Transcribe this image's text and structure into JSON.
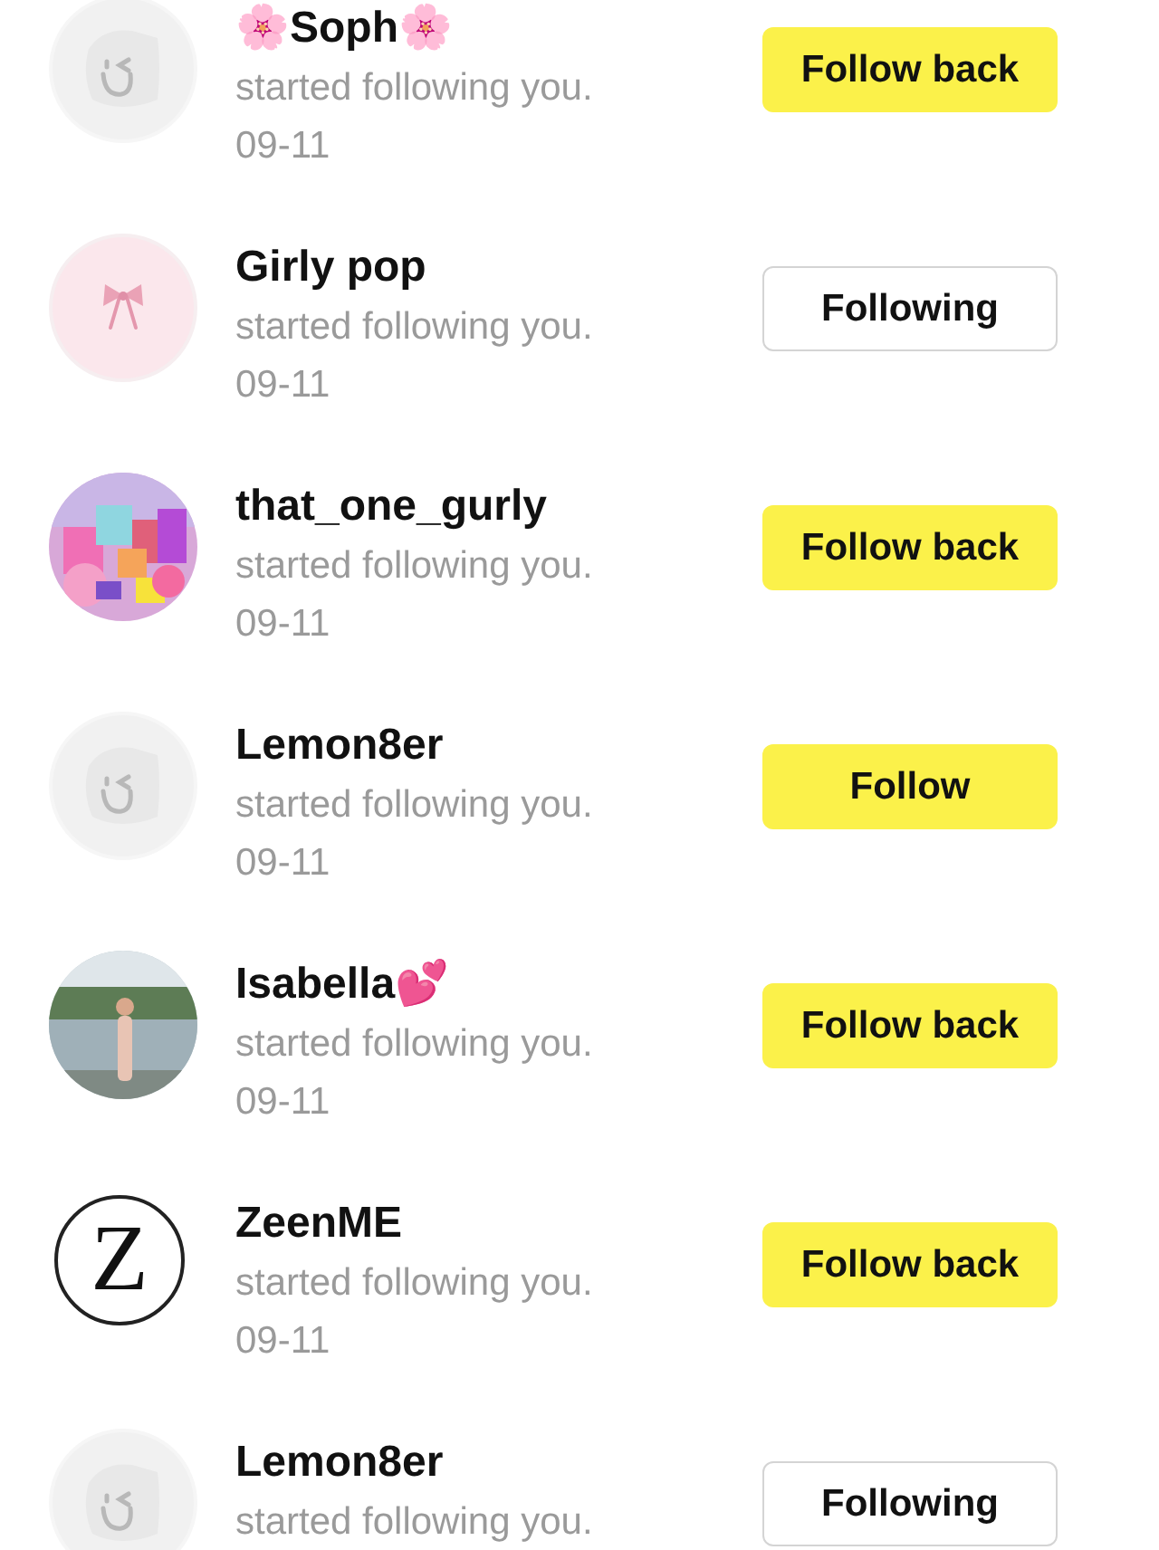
{
  "notifications": [
    {
      "name": "🌸Soph🌸",
      "message": "started following you.",
      "date": "09-11",
      "avatar": {
        "kind": "default"
      },
      "button": {
        "label": "Follow back",
        "kind": "primary"
      }
    },
    {
      "name": "Girly pop",
      "message": "started following you.",
      "date": "09-11",
      "avatar": {
        "kind": "bow"
      },
      "button": {
        "label": "Following",
        "kind": "outline"
      }
    },
    {
      "name": "that_one_gurly",
      "message": "started following you.",
      "date": "09-11",
      "button": {
        "label": "Follow back",
        "kind": "primary"
      }
    },
    {
      "name": "Lemon8er",
      "message": "started following you.",
      "date": "09-11",
      "avatar": {
        "kind": "default"
      },
      "button": {
        "label": "Follow",
        "kind": "primary"
      }
    },
    {
      "name": "Isabella💕",
      "message": "started following you.",
      "date": "09-11",
      "button": {
        "label": "Follow back",
        "kind": "primary"
      }
    },
    {
      "name": "ZeenME",
      "message": "started following you.",
      "date": "09-11",
      "avatar": {
        "kind": "logo",
        "text": "Z"
      },
      "button": {
        "label": "Follow back",
        "kind": "primary"
      }
    },
    {
      "name": "Lemon8er",
      "message": "started following you.",
      "avatar": {
        "kind": "default"
      },
      "button": {
        "label": "Following",
        "kind": "outline"
      }
    }
  ]
}
